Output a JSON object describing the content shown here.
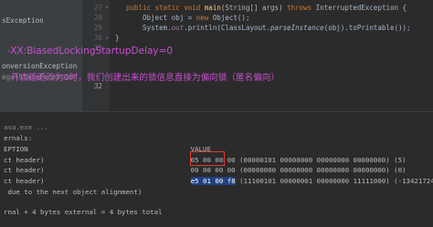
{
  "tree": {
    "items": [
      "sException",
      "onversionException",
      "egalStateException"
    ]
  },
  "editor": {
    "line_numbers": [
      "27",
      "28",
      "29",
      "30",
      "31",
      "32"
    ],
    "lines": [
      {
        "parts": [
          {
            "t": "public static void ",
            "c": "kw"
          },
          {
            "t": "main",
            "c": "fn"
          },
          {
            "t": "(String[] args) ",
            "c": ""
          },
          {
            "t": "throws ",
            "c": "kw"
          },
          {
            "t": "InterruptedException {",
            "c": ""
          }
        ]
      },
      {
        "parts": [
          {
            "t": "    Object obj = ",
            "c": ""
          },
          {
            "t": "new ",
            "c": "kw"
          },
          {
            "t": "Object();",
            "c": ""
          }
        ]
      },
      {
        "parts": [
          {
            "t": "    System.",
            "c": ""
          },
          {
            "t": "out",
            "c": "st"
          },
          {
            "t": ".println(ClassLayout.",
            "c": ""
          },
          {
            "t": "parseInstance",
            "c": "it"
          },
          {
            "t": "(obj).toPrintable());",
            "c": ""
          }
        ]
      },
      {
        "parts": [
          {
            "t": "}",
            "c": ""
          }
        ]
      },
      {
        "parts": [
          {
            "t": "",
            "c": ""
          }
        ]
      },
      {
        "parts": [
          {
            "t": "",
            "c": ""
          }
        ]
      }
    ]
  },
  "annotation": {
    "vm_option": "-XX:BiasedLockingStartupDelay=0",
    "explanation": "开启延迟改为0时，我们创建出来的锁信息直接为偏向锁（匿名偏向）"
  },
  "console": {
    "lines": [
      "ava.exe ...",
      "ernals:",
      "EPTION                                        VALUE",
      "ct header)                                    05 00 00 00 (00000101 00000000 00000000 00000000) (5)",
      "ct header)                                    00 00 00 00 (00000000 00000000 00000000 00000000) (0)",
      "ct header)                                    e5 01 00 f8 (11100101 00000001 00000000 11111000) (-134217243)",
      " due to the next object alignment)",
      "",
      "rnal + 4 bytes external = 4 bytes total"
    ],
    "selected_bytes": "e5 01 00 f8",
    "highlighted_bits": "00101",
    "colors": {
      "selection": "#214283",
      "box": "#e53935",
      "annotation": "#c84fd2"
    }
  }
}
